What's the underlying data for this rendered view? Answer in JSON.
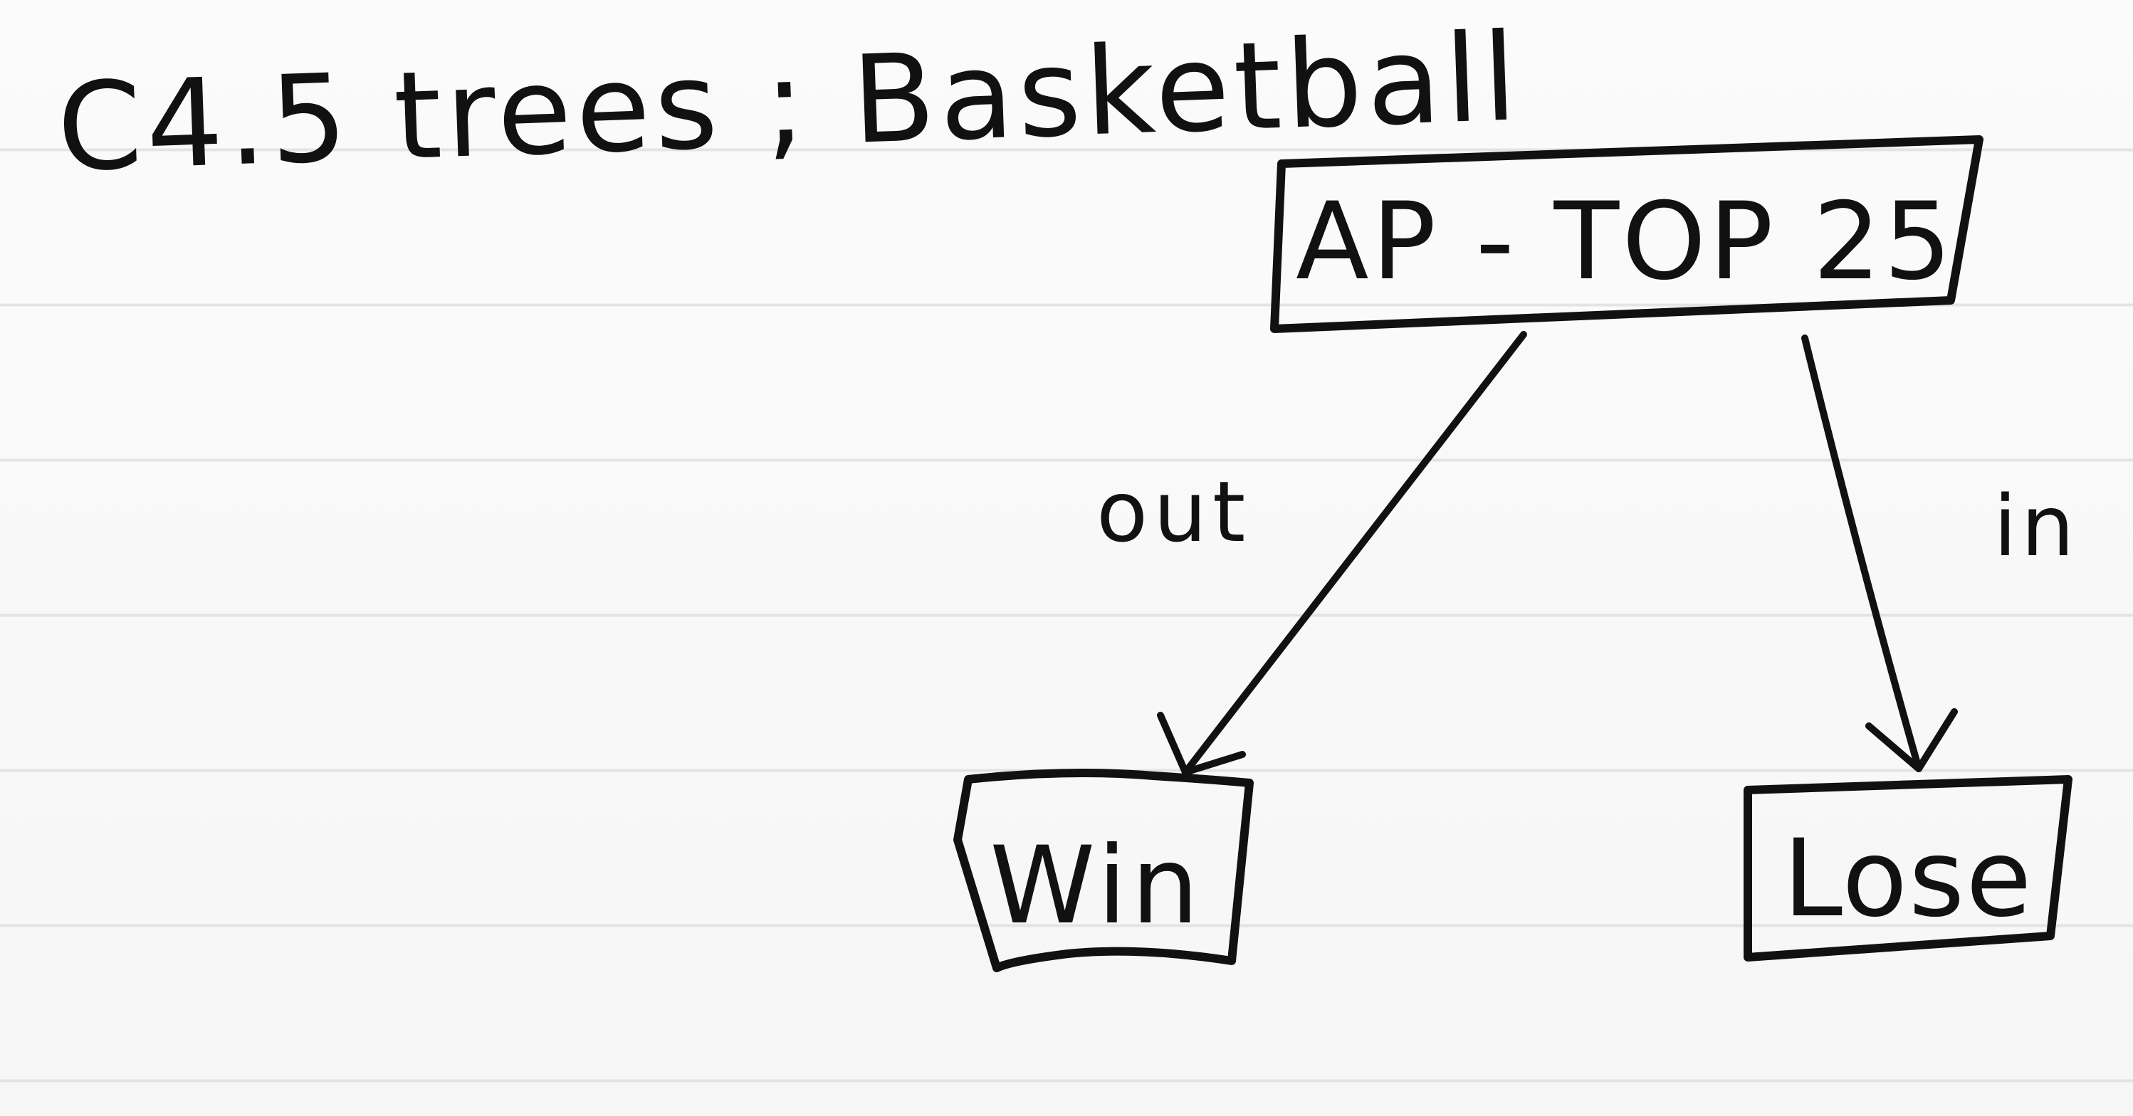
{
  "title": "C4.5 trees ; Basketball",
  "nodes": {
    "root": "AP - TOP 25",
    "win": "Win",
    "lose": "Lose"
  },
  "edges": {
    "left": "out",
    "right": "in"
  },
  "colors": {
    "ink": "#111111",
    "paper": "#fbfbfb",
    "rule_line": "#d2d2d2"
  }
}
